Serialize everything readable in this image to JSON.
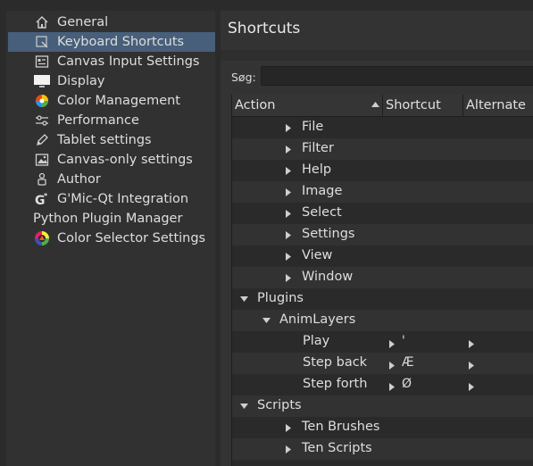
{
  "sidebar": {
    "items": [
      {
        "label": "General",
        "icon": "home-icon"
      },
      {
        "label": "Keyboard Shortcuts",
        "icon": "keyboard-icon",
        "selected": true
      },
      {
        "label": "Canvas Input Settings",
        "icon": "input-settings-icon"
      },
      {
        "label": "Display",
        "icon": "monitor-icon"
      },
      {
        "label": "Color Management",
        "icon": "color-wheel-icon"
      },
      {
        "label": "Performance",
        "icon": "sliders-icon"
      },
      {
        "label": "Tablet settings",
        "icon": "pen-icon"
      },
      {
        "label": "Canvas-only settings",
        "icon": "image-icon"
      },
      {
        "label": "Author",
        "icon": "person-icon"
      },
      {
        "label": "G'Mic-Qt Integration",
        "icon": "gmic-icon"
      },
      {
        "label": "Python Plugin Manager",
        "icon": ""
      },
      {
        "label": "Color Selector Settings",
        "icon": "color-selector-icon"
      }
    ]
  },
  "main": {
    "title": "Shortcuts",
    "search": {
      "label": "Søg:",
      "value": "",
      "placeholder": ""
    },
    "columns": {
      "action": "Action",
      "shortcut": "Shortcut",
      "alternate": "Alternate"
    },
    "rows": [
      {
        "label": "File",
        "level": 1,
        "state": "collapsed"
      },
      {
        "label": "Filter",
        "level": 1,
        "state": "collapsed"
      },
      {
        "label": "Help",
        "level": 1,
        "state": "collapsed"
      },
      {
        "label": "Image",
        "level": 1,
        "state": "collapsed"
      },
      {
        "label": "Select",
        "level": 1,
        "state": "collapsed"
      },
      {
        "label": "Settings",
        "level": 1,
        "state": "collapsed"
      },
      {
        "label": "View",
        "level": 1,
        "state": "collapsed"
      },
      {
        "label": "Window",
        "level": 1,
        "state": "collapsed"
      },
      {
        "label": "Plugins",
        "level": 0,
        "state": "expanded"
      },
      {
        "label": "AnimLayers",
        "level": 1,
        "state": "expanded"
      },
      {
        "label": "Play",
        "level": 2,
        "state": "leaf",
        "shortcut": "'",
        "alternate": ""
      },
      {
        "label": "Step back",
        "level": 2,
        "state": "leaf",
        "shortcut": "Æ",
        "alternate": ""
      },
      {
        "label": "Step forth",
        "level": 2,
        "state": "leaf",
        "shortcut": "Ø",
        "alternate": ""
      },
      {
        "label": "Scripts",
        "level": 0,
        "state": "expanded"
      },
      {
        "label": "Ten Brushes",
        "level": 1,
        "state": "collapsed"
      },
      {
        "label": "Ten Scripts",
        "level": 1,
        "state": "collapsed"
      }
    ]
  },
  "colors": {
    "selection": "#475f7a",
    "background": "#2b2b2b"
  }
}
